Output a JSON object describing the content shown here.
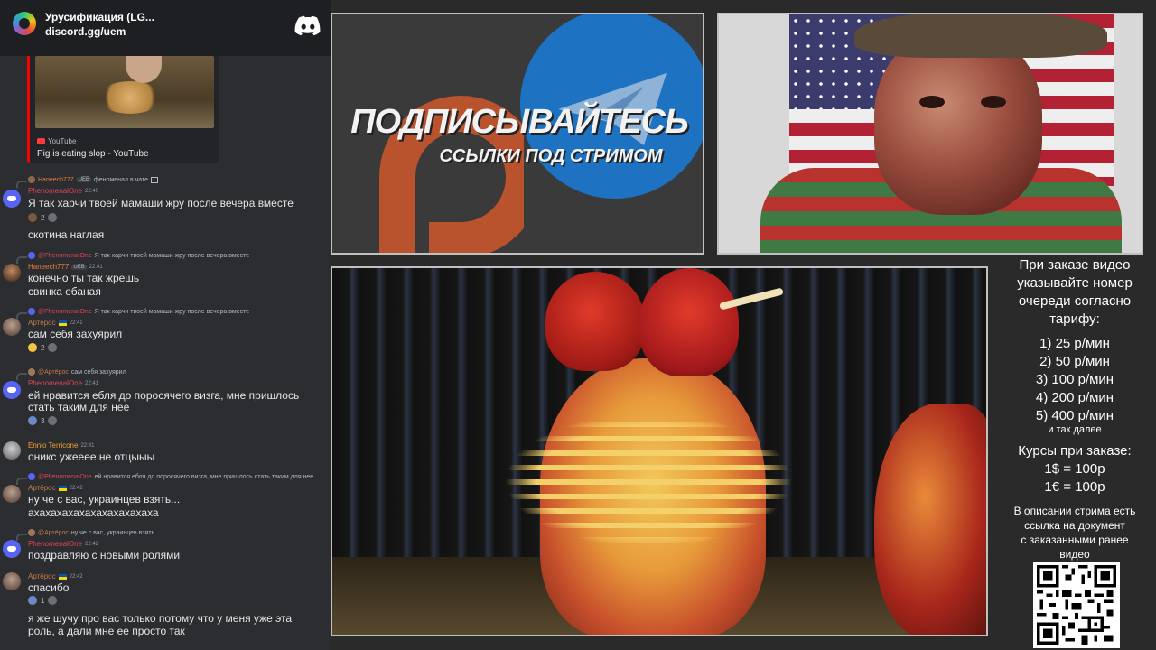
{
  "discord": {
    "server_name": "Урусификация (LG...",
    "invite": "discord.gg/uem",
    "embed": {
      "provider": "YouTube",
      "title": "Pig is eating slop - YouTube"
    },
    "messages": [
      {
        "reply_user": "Haneech777",
        "reply_badge": "UEB",
        "reply_text": "феноменал в чате",
        "user": "PhenomenalOne",
        "user_color": "#e0455a",
        "time": "22:40",
        "lines": [
          "Я так харчи твоей мамаши жру после вечера вместе",
          "скотина наглая"
        ],
        "reaction_count": "2"
      },
      {
        "reply_user": "@PhenomenalOne",
        "reply_text": "Я так харчи твоей мамаши жру после вечера вместе",
        "user": "Haneech777",
        "user_color": "#f07c3c",
        "badge": "UEB",
        "time": "22:41",
        "lines": [
          "конечно ты так жрешь",
          "свинка ебаная"
        ]
      },
      {
        "reply_user": "@PhenomenalOne",
        "reply_text": "Я так харчи твоей мамаши жру после вечера вместе",
        "user": "Артёрос",
        "user_color": "#c27c4a",
        "time": "22:41",
        "lines": [
          "сам себя захуярил"
        ],
        "reaction_count": "2"
      },
      {
        "reply_user": "@Артёрос",
        "reply_text": "сам себя захуярил",
        "user": "PhenomenalOne",
        "user_color": "#e0455a",
        "time": "22:41",
        "lines": [
          "ей нравится ебля до поросячего визга, мне пришлось",
          "стать таким для нее"
        ],
        "reaction_count": "3"
      },
      {
        "user": "Ennio Terricone",
        "user_color": "#f0a030",
        "time": "22:41",
        "lines": [
          "оникс ужееее не отцыыы"
        ]
      },
      {
        "reply_user": "@PhenomenalOne",
        "reply_text": "ей нравится ебля до поросячего визга, мне пришлось стать таким для нее",
        "user": "Артёрос",
        "user_color": "#c27c4a",
        "time": "22:42",
        "lines": [
          "ну че с вас, украинцев взять...",
          "ахахахахахахахахахахаха"
        ]
      },
      {
        "reply_user": "@Артёрос",
        "reply_text": "ну че с вас, украинцев взять...",
        "user": "PhenomenalOne",
        "user_color": "#e0455a",
        "time": "22:42",
        "lines": [
          "поздравляю с новыми ролями"
        ]
      },
      {
        "user": "Артёрос",
        "user_color": "#c27c4a",
        "time": "22:42",
        "lines": [
          "спасибо"
        ],
        "reaction_count": "1"
      },
      {
        "lines": [
          "я же шучу про вас только потому что у меня уже эта",
          "роль, а дали мне ее просто так"
        ]
      }
    ]
  },
  "banner": {
    "title": "ПОДПИСЫВАЙТЕСЬ",
    "subtitle": "ССЫЛКИ ПОД СТРИМОМ"
  },
  "info": {
    "heading_lines": [
      "При заказе видео",
      "указывайте номер",
      "очереди согласно",
      "тарифу:"
    ],
    "tariffs": [
      "1) 25 р/мин",
      "2) 50 р/мин",
      "3) 100 р/мин",
      "4) 200 р/мин",
      "5) 400 р/мин"
    ],
    "etc": "и так далее",
    "rates_heading": "Курсы при заказе:",
    "rates": [
      "1$ = 100р",
      "1€ = 100р"
    ],
    "note_lines": [
      "В описании стрима есть",
      "ссылка на документ",
      "с заказанными ранее",
      "видео"
    ]
  },
  "colors": {
    "discord_bg": "#2b2d31",
    "discord_header": "#1e1f22",
    "blurple": "#5865f2",
    "telegram_blue": "#1d72c2",
    "boosty_orange": "#b8532e"
  }
}
